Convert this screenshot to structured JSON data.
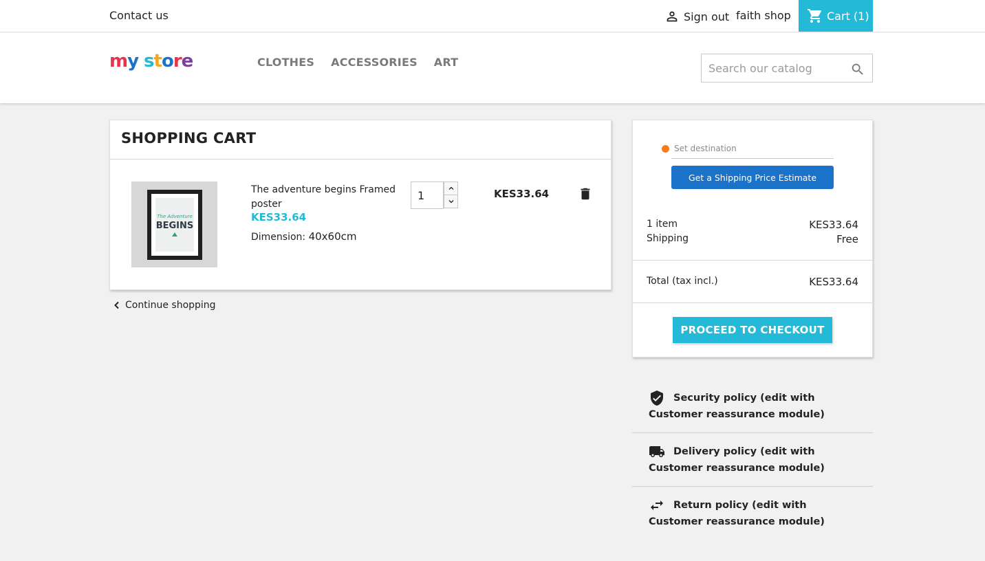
{
  "topbar": {
    "contact": "Contact us",
    "signout": "Sign out",
    "shop_name": "faith shop",
    "cart": "Cart (1)"
  },
  "header": {
    "logo": "my store",
    "menu": [
      "CLOTHES",
      "ACCESSORIES",
      "ART"
    ],
    "search_placeholder": "Search our catalog"
  },
  "cart": {
    "title": "SHOPPING CART",
    "item": {
      "name": "The adventure begins Framed poster",
      "price": "KES33.64",
      "dimension_label": "Dimension:",
      "dimension_value": "40x60cm",
      "quantity": "1",
      "line_total": "KES33.64",
      "poster_text_small": "The Adventure",
      "poster_text_big": "BEGINS"
    },
    "continue": "Continue shopping"
  },
  "summary": {
    "set_destination": "Set destination",
    "estimate_button": "Get a Shipping Price Estimate",
    "items_label": "1 item",
    "items_value": "KES33.64",
    "shipping_label": "Shipping",
    "shipping_value": "Free",
    "total_label": "Total (tax incl.)",
    "total_value": "KES33.64",
    "checkout_button": "PROCEED TO CHECKOUT"
  },
  "reassurance": [
    {
      "icon": "shield-check-icon",
      "text": "Security policy (edit with Customer reassurance module)"
    },
    {
      "icon": "truck-icon",
      "text": "Delivery policy (edit with Customer reassurance module)"
    },
    {
      "icon": "swap-arrows-icon",
      "text": "Return policy (edit with Customer reassurance module)"
    }
  ],
  "colors": {
    "accent": "#24b9d7",
    "estimate_button": "#1a73c8",
    "destination_dot": "#f57d1f"
  }
}
